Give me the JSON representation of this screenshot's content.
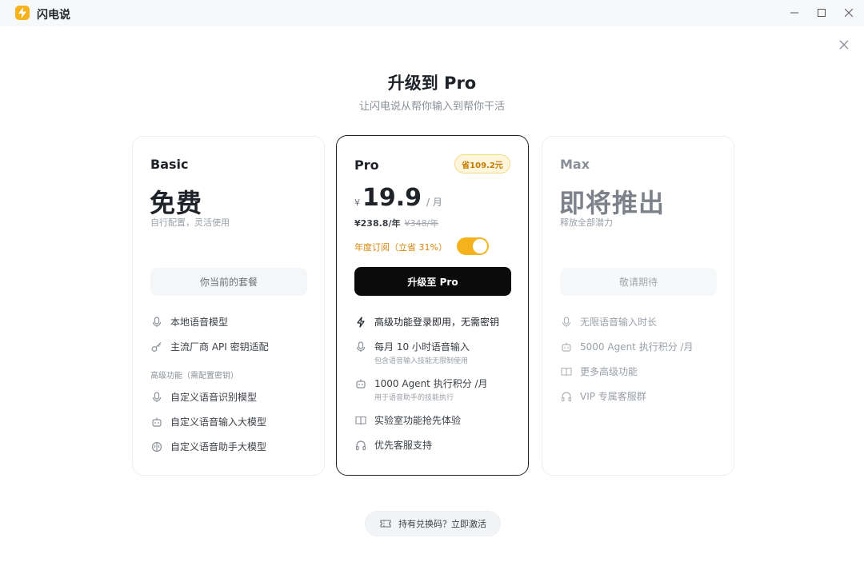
{
  "app": {
    "title": "闪电说"
  },
  "header": {
    "title": "升级到 Pro",
    "subtitle": "让闪电说从帮你输入到帮你干活"
  },
  "plans": {
    "basic": {
      "name": "Basic",
      "headline": "免费",
      "description": "自行配置，灵活使用",
      "button_label": "你当前的套餐",
      "features": [
        {
          "icon": "mic-icon",
          "label": "本地语音模型"
        },
        {
          "icon": "key-icon",
          "label": "主流厂商 API 密钥适配"
        }
      ],
      "section_label": "高级功能（需配置密钥）",
      "advanced_features": [
        {
          "icon": "mic-icon",
          "label": "自定义语音识别模型"
        },
        {
          "icon": "robot-icon",
          "label": "自定义语音输入大模型"
        },
        {
          "icon": "brain-icon",
          "label": "自定义语音助手大模型"
        }
      ]
    },
    "pro": {
      "name": "Pro",
      "save_badge": "省109.2元",
      "currency": "¥",
      "price": "19.9",
      "price_unit": "/ 月",
      "yearly_price": "¥238.8/年",
      "yearly_original": "¥348/年",
      "annual_label": "年度订阅（立省 31%）",
      "annual_enabled": true,
      "button_label": "升级至 Pro",
      "features": [
        {
          "icon": "bolt-icon",
          "label": "高级功能登录即用，无需密钥",
          "sub": ""
        },
        {
          "icon": "mic-icon",
          "label": "每月 10 小时语音输入",
          "sub": "包含语音输入技能无限制使用"
        },
        {
          "icon": "robot-icon",
          "label": "1000 Agent 执行积分 /月",
          "sub": "用于语音助手的技能执行"
        },
        {
          "icon": "book-icon",
          "label": "实验室功能抢先体验",
          "sub": ""
        },
        {
          "icon": "headphones-icon",
          "label": "优先客服支持",
          "sub": ""
        }
      ]
    },
    "max": {
      "name": "Max",
      "headline": "即将推出",
      "description": "释放全部潜力",
      "button_label": "敬请期待",
      "features": [
        {
          "icon": "mic-icon",
          "label": "无限语音输入时长"
        },
        {
          "icon": "robot-icon",
          "label": "5000 Agent 执行积分 /月"
        },
        {
          "icon": "book-icon",
          "label": "更多高级功能"
        },
        {
          "icon": "headphones-icon",
          "label": "VIP 专属客服群"
        }
      ]
    }
  },
  "redeem": {
    "icon": "ticket-icon",
    "label": "持有兑换码？立即激活"
  },
  "colors": {
    "accent": "#f5b21c",
    "primary_button": "#0b0b0c",
    "save_badge_text": "#c57a00",
    "annual_label": "#d9860b"
  }
}
